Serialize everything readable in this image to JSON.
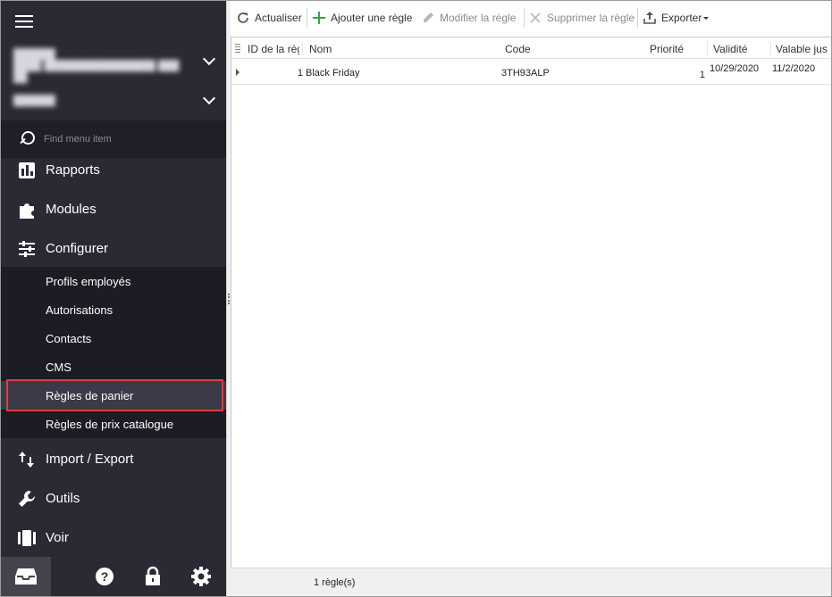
{
  "sidebar": {
    "search_placeholder": "Find menu item",
    "menu": [
      {
        "label": "Rapports",
        "icon": "bar-chart-icon"
      },
      {
        "label": "Modules",
        "icon": "puzzle-icon"
      },
      {
        "label": "Configurer",
        "icon": "sliders-icon"
      },
      {
        "label": "Import / Export",
        "icon": "arrows-updown-icon"
      },
      {
        "label": "Outils",
        "icon": "wrench-icon"
      },
      {
        "label": "Voir",
        "icon": "columns-icon"
      }
    ],
    "submenu": [
      {
        "label": "Profils employés"
      },
      {
        "label": "Autorisations"
      },
      {
        "label": "Contacts"
      },
      {
        "label": "CMS"
      },
      {
        "label": "Règles de panier",
        "active": true
      },
      {
        "label": "Règles de prix catalogue"
      }
    ],
    "bottom_icons": [
      "inbox-icon",
      "help-icon",
      "lock-icon",
      "gear-icon"
    ]
  },
  "toolbar": {
    "refresh_label": "Actualiser",
    "add_label": "Ajouter une règle",
    "edit_label": "Modifier la règle",
    "delete_label": "Supprimer la règle",
    "export_label": "Exporter"
  },
  "grid": {
    "columns": [
      "ID de la règ",
      "Nom",
      "Code",
      "Priorité",
      "Validité",
      "Valable jus"
    ],
    "rows": [
      {
        "id": "1",
        "name": "Black Friday",
        "code": "3TH93ALP",
        "priority": "1",
        "valid_from": "10/29/2020",
        "valid_to": "11/2/2020"
      }
    ]
  },
  "status": {
    "count_text": "1 règle(s)"
  },
  "colors": {
    "sidebar_bg": "#2a2a35",
    "active_outline": "#e03b3b",
    "add_green": "#3aa63a"
  }
}
